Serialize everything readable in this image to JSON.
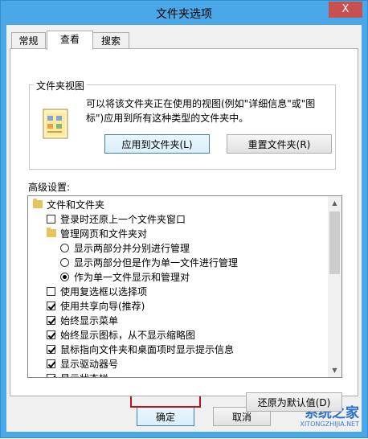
{
  "window": {
    "title": "文件夹选项",
    "close_symbol": "X"
  },
  "tabs": [
    {
      "label": "常规"
    },
    {
      "label": "查看"
    },
    {
      "label": "搜索"
    }
  ],
  "folder_views": {
    "legend": "文件夹视图",
    "description": "可以将该文件夹正在使用的视图(例如\"详细信息\"或\"图标\")应用到所有这种类型的文件夹中。",
    "apply_button": "应用到文件夹(L)",
    "reset_button": "重置文件夹(R)"
  },
  "advanced": {
    "label": "高级设置:",
    "items": [
      {
        "kind": "folder",
        "label": "文件和文件夹",
        "indent": 0
      },
      {
        "kind": "check",
        "checked": false,
        "label": "登录时还原上一个文件夹窗口",
        "indent": 1
      },
      {
        "kind": "folder",
        "label": "管理网页和文件夹对",
        "indent": 1
      },
      {
        "kind": "radio",
        "checked": false,
        "label": "显示两部分并分别进行管理",
        "indent": 2
      },
      {
        "kind": "radio",
        "checked": false,
        "label": "显示两部分但是作为单一文件进行管理",
        "indent": 2
      },
      {
        "kind": "radio",
        "checked": true,
        "label": "作为单一文件显示和管理对",
        "indent": 2
      },
      {
        "kind": "check",
        "checked": false,
        "label": "使用复选框以选择项",
        "indent": 1
      },
      {
        "kind": "check",
        "checked": true,
        "label": "使用共享向导(推荐)",
        "indent": 1
      },
      {
        "kind": "check",
        "checked": true,
        "label": "始终显示菜单",
        "indent": 1
      },
      {
        "kind": "check",
        "checked": true,
        "label": "始终显示图标，从不显示缩略图",
        "indent": 1
      },
      {
        "kind": "check",
        "checked": true,
        "label": "鼠标指向文件夹和桌面项时显示提示信息",
        "indent": 1
      },
      {
        "kind": "check",
        "checked": true,
        "label": "显示驱动器号",
        "indent": 1
      },
      {
        "kind": "check",
        "checked": true,
        "label": "显示状态栏",
        "indent": 1
      }
    ],
    "restore_defaults_button": "还原为默认值(D)"
  },
  "footer": {
    "ok_button": "确定",
    "cancel_button": "取消"
  },
  "watermark": {
    "name": "系统之家",
    "url": "XITONGZHIJIA.NET"
  },
  "colors": {
    "title_bar": "#4aa8e8",
    "close_button": "#c75050",
    "highlight_box": "#b8141a",
    "watermark": "#2a6fc9"
  }
}
